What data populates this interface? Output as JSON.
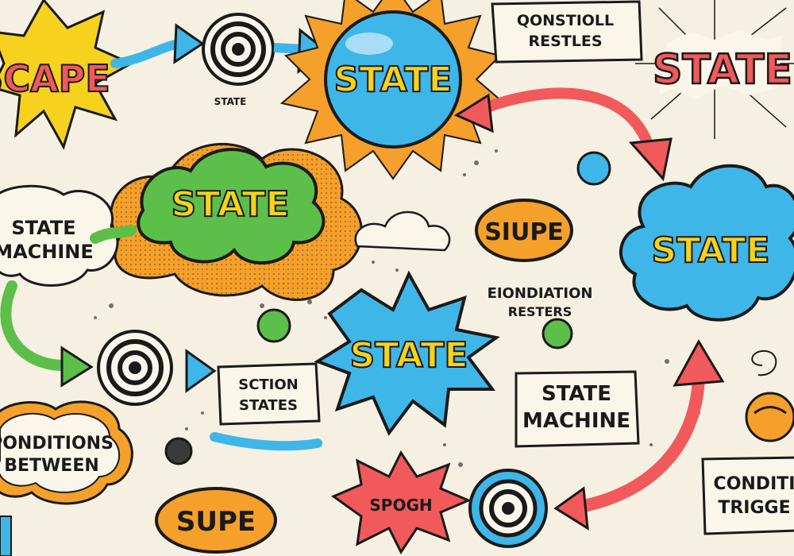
{
  "colors": {
    "background": "#f6f0e2",
    "ink": "#1a1a1a",
    "blue": "#3fb6e8",
    "green": "#5cbf4a",
    "orange": "#f5a02a",
    "yellow": "#f6d21e",
    "red": "#f2595b",
    "paper": "#fbf6ea"
  },
  "labels": {
    "escape_burst": "SCAPE",
    "conditional_results": "QONSTIOLL\nRESTLES",
    "top_state": "STATE",
    "top_right_state": "STATE",
    "green_cloud_state": "STATE",
    "state_machine_left": "STATE\nMACHINE",
    "supe_middle": "SIUPE",
    "foundation_rules": "EIONDIATION\nRESTERS",
    "blue_cloud_state": "STATE",
    "starburst_state": "STATE",
    "section_states": "SCTION\nSTATES",
    "state_machine_right": "STATE\nMACHINE",
    "conditions_between": "PONDITIONS\nBETWEEN",
    "supe_bottom": "SUPE",
    "splosh": "SPOGH",
    "condition_trigger": "CONDITI\nTRIGGE",
    "small_caption": "STATE"
  }
}
